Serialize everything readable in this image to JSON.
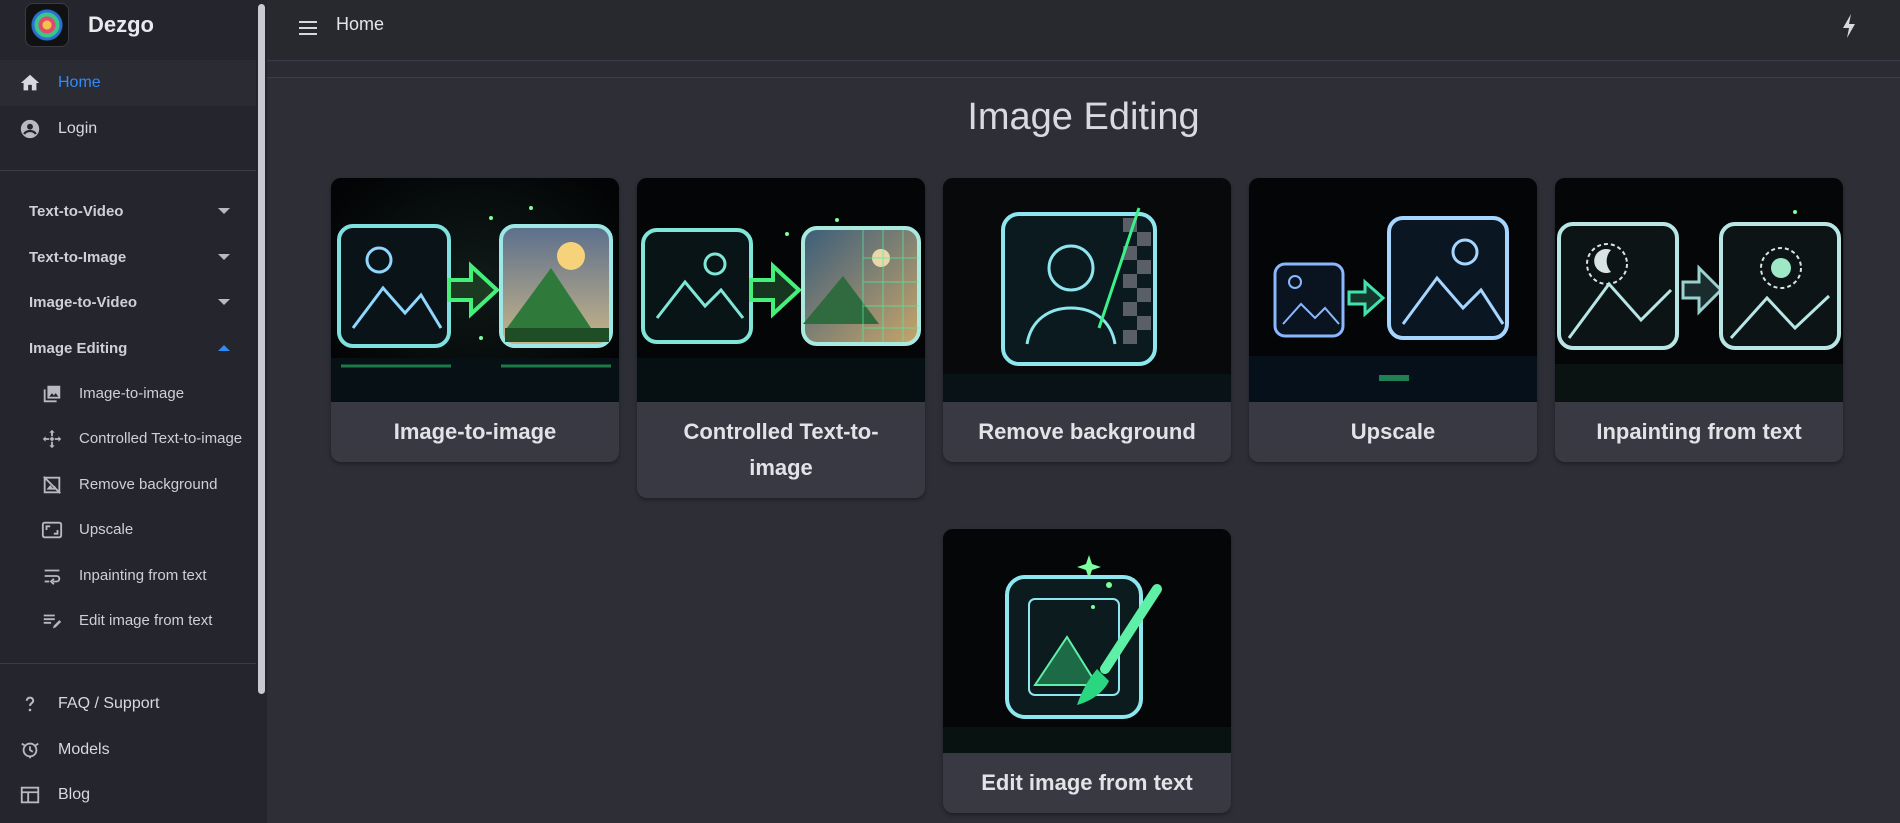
{
  "brand": {
    "name": "Dezgo"
  },
  "topbar": {
    "title": "Home"
  },
  "nav_top": [
    {
      "label": "Home",
      "icon": "home-icon",
      "active": true
    },
    {
      "label": "Login",
      "icon": "account-icon",
      "active": false
    }
  ],
  "sections": [
    {
      "label": "Text-to-Video",
      "expanded": false
    },
    {
      "label": "Text-to-Image",
      "expanded": false
    },
    {
      "label": "Image-to-Video",
      "expanded": false
    },
    {
      "label": "Image Editing",
      "expanded": true
    }
  ],
  "image_editing_items": [
    {
      "label": "Image-to-image",
      "icon": "image-stack-icon"
    },
    {
      "label": "Controlled Text-to-image",
      "icon": "move-arrows-icon"
    },
    {
      "label": "Remove background",
      "icon": "image-off-icon"
    },
    {
      "label": "Upscale",
      "icon": "aspect-ratio-icon"
    },
    {
      "label": "Inpainting from text",
      "icon": "wrap-text-icon"
    },
    {
      "label": "Edit image from text",
      "icon": "edit-note-icon"
    }
  ],
  "nav_bottom": [
    {
      "label": "FAQ / Support",
      "icon": "question-icon"
    },
    {
      "label": "Models",
      "icon": "model-icon"
    },
    {
      "label": "Blog",
      "icon": "blog-icon"
    }
  ],
  "main": {
    "title": "Image Editing",
    "cards": [
      {
        "label": "Image-to-image",
        "image": "image-to-image-illustration"
      },
      {
        "label": "Controlled Text-to-image",
        "image": "controlled-illustration"
      },
      {
        "label": "Remove background",
        "image": "remove-background-illustration"
      },
      {
        "label": "Upscale",
        "image": "upscale-illustration"
      },
      {
        "label": "Inpainting from text",
        "image": "inpainting-illustration"
      },
      {
        "label": "Edit image from text",
        "image": "edit-image-illustration"
      }
    ]
  },
  "colors": {
    "accent": "#2f8cf5",
    "background": "#2e2e37",
    "sidebar": "#25252d",
    "card": "#393943",
    "neon": "#39e07a"
  }
}
